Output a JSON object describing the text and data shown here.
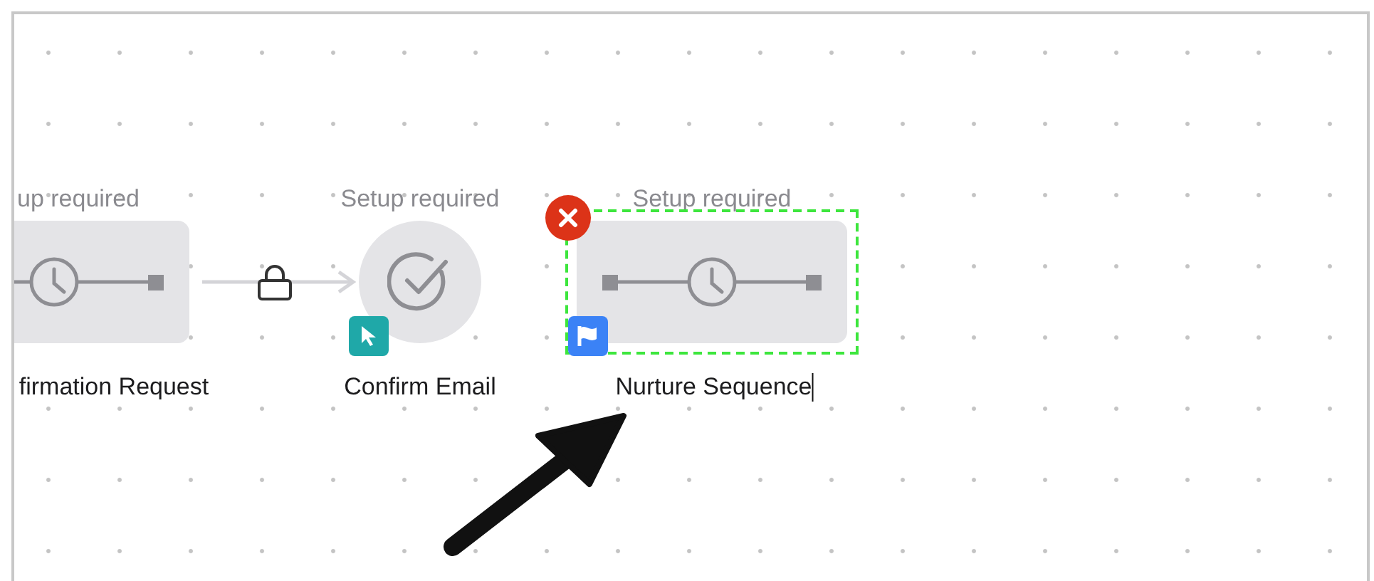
{
  "canvas": {
    "nodes": [
      {
        "kind": "delay",
        "status": "up required",
        "label": "firmation Request",
        "selected": false,
        "editing": false
      },
      {
        "kind": "confirm",
        "status": "Setup required",
        "label": "Confirm Email",
        "selected": false,
        "editing": false,
        "badge": {
          "kind": "cursor"
        }
      },
      {
        "kind": "delay",
        "status": "Setup required",
        "label": "Nurture Sequence",
        "selected": true,
        "editing": true,
        "badge": {
          "kind": "flag"
        }
      }
    ],
    "connectors": [
      {
        "locked": true
      }
    ]
  }
}
